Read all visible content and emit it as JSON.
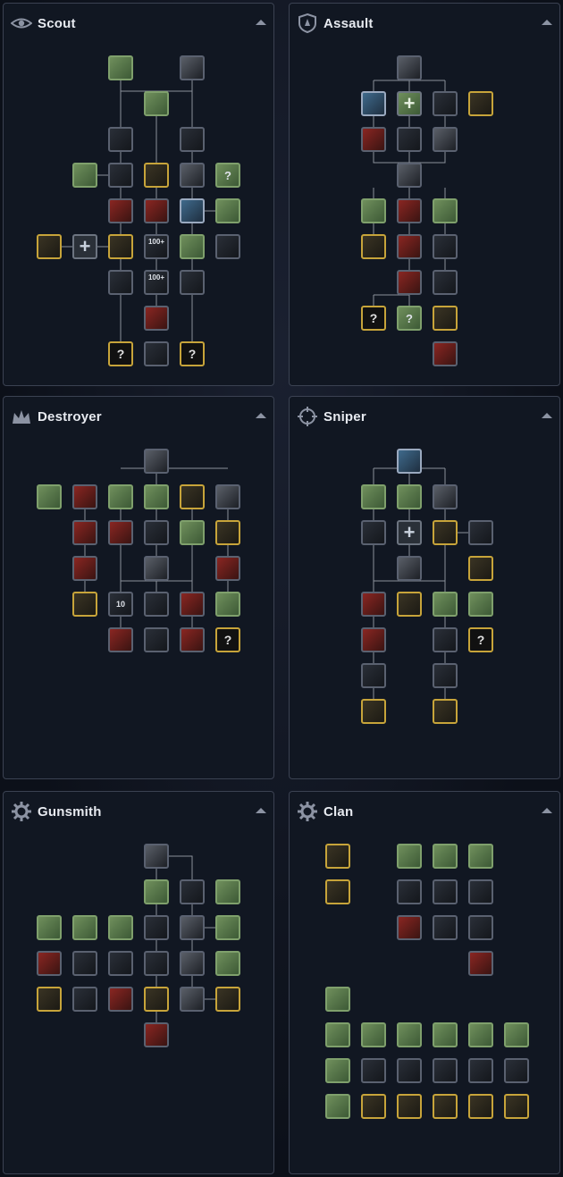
{
  "panels": [
    {
      "id": "scout",
      "title": "Scout",
      "icon": "eye-icon"
    },
    {
      "id": "assault",
      "title": "Assault",
      "icon": "shield-emblem-icon"
    },
    {
      "id": "destroyer",
      "title": "Destroyer",
      "icon": "crown-icon"
    },
    {
      "id": "sniper",
      "title": "Sniper",
      "icon": "crosshair-icon"
    },
    {
      "id": "gunsmith",
      "title": "Gunsmith",
      "icon": "gear-icon"
    },
    {
      "id": "clan",
      "title": "Clan",
      "icon": "gear-icon"
    }
  ],
  "common": {
    "locked_glyph": "?",
    "plus_glyph": "+"
  },
  "scout_labels": {
    "hp100": "100+"
  },
  "destroyer_labels": {
    "ten": "10"
  }
}
